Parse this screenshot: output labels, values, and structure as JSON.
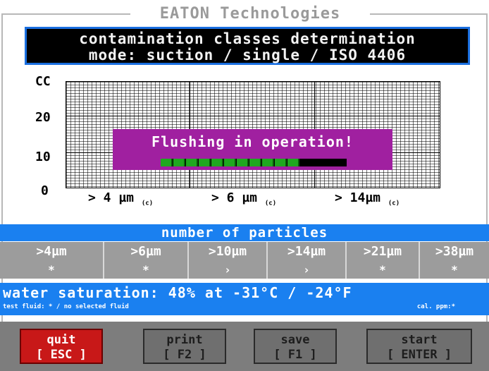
{
  "brand": "EATON Technologies",
  "header": {
    "line1": "contamination classes determination",
    "line2": "mode: suction / single / ISO 4406"
  },
  "chart": {
    "y_unit": "CC",
    "y_ticks": [
      "20",
      "10",
      "0"
    ],
    "x_ticks": [
      {
        "label": "> 4 µm",
        "sub": "(c)"
      },
      {
        "label": "> 6 µm",
        "sub": "(c)"
      },
      {
        "label": "> 14µm",
        "sub": "(c)"
      }
    ]
  },
  "popup": {
    "text": "Flushing in operation!",
    "progress_segments_filled": 11,
    "progress_segments_total": 15,
    "progress_color": "#1fa81f"
  },
  "particles": {
    "title": "number of particles",
    "headers": [
      ">4µm",
      ">6µm",
      ">10µm",
      ">14µm",
      ">21µm",
      ">38µm"
    ],
    "values": [
      "*",
      "*",
      "›",
      "›",
      "*",
      "*"
    ]
  },
  "water": {
    "main": "water saturation: 48% at -31°C / -24°F",
    "sub": "test fluid: * / no selected fluid",
    "cal": "cal. ppm:*"
  },
  "footer": {
    "quit": {
      "line1": "quit",
      "line2": "[ ESC ]"
    },
    "print": {
      "line1": "print",
      "line2": "[ F2 ]"
    },
    "save": {
      "line1": "save",
      "line2": "[ F1 ]"
    },
    "start": {
      "line1": "start",
      "line2": "[ ENTER ]"
    }
  },
  "colors": {
    "accent_blue": "#1a80f0",
    "popup_purple": "#a020a0",
    "quit_red": "#c81818"
  }
}
